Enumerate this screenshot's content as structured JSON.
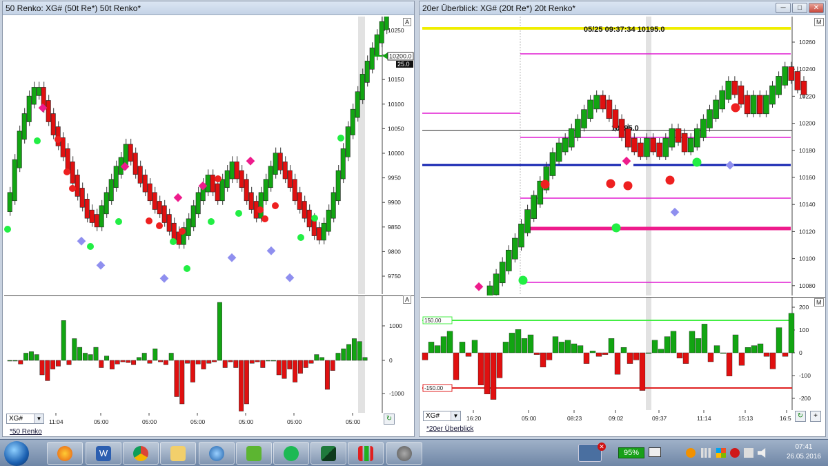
{
  "left_window": {
    "title": "50 Renko: XG# (50t Re*) 50t Renko*",
    "a_label": "A",
    "price_last": "10200.0",
    "price_box": "25.0",
    "y_ticks": [
      "10250",
      "10200",
      "10150",
      "10100",
      "10050",
      "10000",
      "9950",
      "9900",
      "9850",
      "9800",
      "9750"
    ],
    "osc_a_label": "A",
    "osc_ticks": [
      "1000",
      "0",
      "-1000"
    ],
    "x_labels": [
      "11:04",
      "05:00",
      "05:00",
      "05:00",
      "05:00",
      "05:00",
      "05:00"
    ],
    "instrument": "XG#",
    "tab": "*50 Renko"
  },
  "right_window": {
    "title": "20er Überblick: XG# (20t Re*) 20t Renko*",
    "annotation": "05/25 09:37:34  10195.0",
    "line_label": "10195.0",
    "m_label": "M",
    "y_ticks": [
      "10260",
      "10240",
      "10220",
      "10200",
      "10180",
      "10160",
      "10140",
      "10120",
      "10100",
      "10080"
    ],
    "osc_m_label": "M",
    "osc_ticks": [
      "200",
      "100",
      "0",
      "-100",
      "-200"
    ],
    "level_upper": "150.00",
    "level_lower": "-150.00",
    "x_labels": [
      "16:20",
      "05:00",
      "08:23",
      "09:02",
      "09:37",
      "11:14",
      "15:13",
      "16:5"
    ],
    "instrument": "XG#",
    "tab": "*20er Überblick",
    "plus": "+"
  },
  "taskbar": {
    "battery": "95%",
    "time": "07:41",
    "date": "26.05.2016",
    "apps": [
      "start",
      "firefox",
      "word",
      "chrome",
      "explorer",
      "thunderbird",
      "evernote",
      "spotify",
      "ninjatrader",
      "chart",
      "gimp"
    ]
  },
  "colors": {
    "up": "#12a512",
    "down": "#e01010",
    "green_dot": "#22ee44",
    "red_dot": "#ee2020",
    "magenta": "#ee1c8c",
    "violet": "#8f8fef",
    "yellow": "#f0ee00",
    "blue": "#1020b0"
  }
}
